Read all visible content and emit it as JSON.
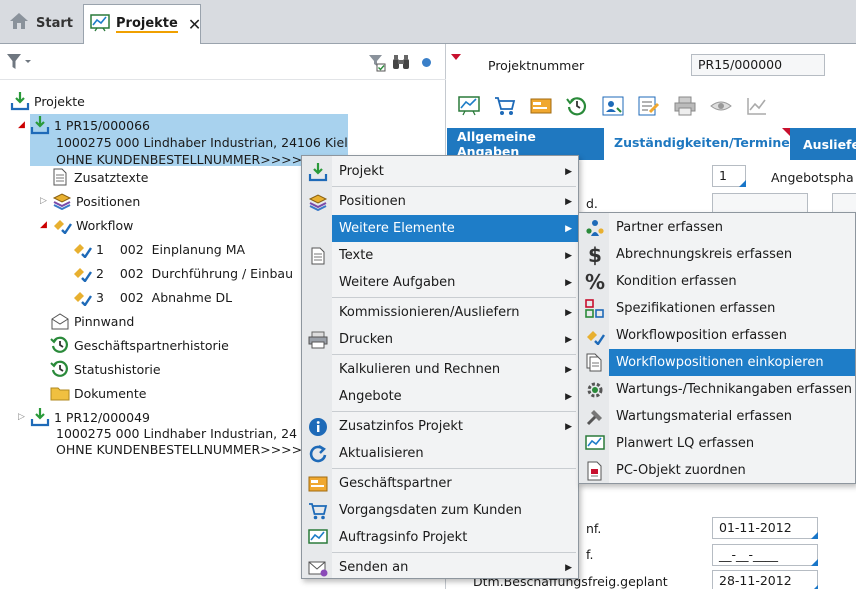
{
  "tabs": {
    "start": "Start",
    "projekte": "Projekte"
  },
  "tree": {
    "root": "Projekte",
    "p1_line1": "1 PR15/000066",
    "p1_line2": "1000275 000 Lindhaber Industrian, 24106 Kiel",
    "p1_line3": "OHNE KUNDENBESTELLNUMMER>>>>>>>>>>>",
    "zusatztexte": "Zusatztexte",
    "positionen": "Positionen",
    "workflow": "Workflow",
    "wf1": "1    002  Einplanung MA",
    "wf2": "2    002  Durchführung / Einbau",
    "wf3": "3    002  Abnahme DL",
    "pinnwand": "Pinnwand",
    "gph": "Geschäftspartnerhistorie",
    "status": "Statushistorie",
    "dokumente": "Dokumente",
    "p2_line1": "1 PR12/000049",
    "p2_line2": "1000275 000 Lindhaber Industrian, 24",
    "p2_line3": "OHNE KUNDENBESTELLNUMMER>>>>>>"
  },
  "right": {
    "projektnummer_label": "Projektnummer",
    "projektnummer_value": "PR15/000000",
    "tab1": "Allgemeine Angaben",
    "tab2": "Zuständigkeiten/Termine",
    "tab3": "Ausliefe",
    "field_num": "1",
    "angebots_label": "Angebotspha",
    "d_label": "d.",
    "nf_label": "nf.",
    "nf_value": "01-11-2012",
    "f_label": "f.",
    "f_value": "__-__-____",
    "dtm_label": "Dtm.Beschaffungsfreig.geplant",
    "dtm_value": "28-11-2012"
  },
  "menu1": [
    "Projekt",
    "Positionen",
    "Weitere Elemente",
    "Texte",
    "Weitere Aufgaben",
    "Kommissionieren/Ausliefern",
    "Drucken",
    "Kalkulieren und Rechnen",
    "Angebote",
    "Zusatzinfos Projekt",
    "Aktualisieren",
    "Geschäftspartner",
    "Vorgangsdaten zum Kunden",
    "Auftragsinfo Projekt",
    "Senden an"
  ],
  "menu2": [
    "Partner erfassen",
    "Abrechnungskreis erfassen",
    "Kondition erfassen",
    "Spezifikationen erfassen",
    "Workflowposition erfassen",
    "Workflowpositionen einkopieren",
    "Wartungs-/Technikangaben erfassen",
    "Wartungsmaterial erfassen",
    "Planwert LQ erfassen",
    "PC-Objekt zuordnen"
  ],
  "colors": {
    "accent": "#1e7dc8",
    "selection": "#a8d2ee",
    "tab_active_underline": "#f0a000"
  }
}
